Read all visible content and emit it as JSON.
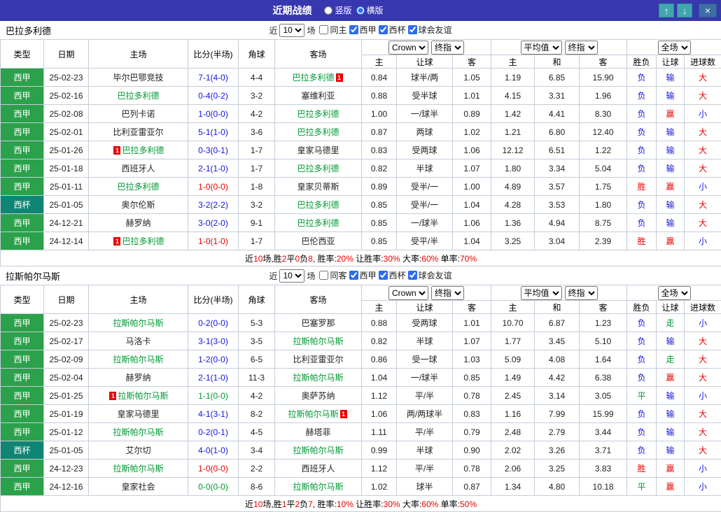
{
  "titlebar": {
    "title": "近期战绩",
    "view_options": [
      {
        "label": "竖版",
        "selected": false
      },
      {
        "label": "横版",
        "selected": true
      }
    ],
    "up_icon": "↑",
    "down_icon": "↓",
    "close_icon": "×"
  },
  "colors": {
    "titlebar_bg": "#3737af",
    "liga_badge_bg": "#2ba14b",
    "cup_badge_bg": "#0f8573",
    "win_red": "#e80000",
    "loss_blue": "#1515dd",
    "draw_green": "#009933",
    "focal_team_green": "#009933"
  },
  "table_header": {
    "static_cols": [
      "类型",
      "日期",
      "主场",
      "比分(半场)",
      "角球",
      "客场"
    ],
    "group1": {
      "selects": [
        "Crown",
        "终指"
      ],
      "cols": [
        "主",
        "让球",
        "客"
      ]
    },
    "group2": {
      "selects": [
        "平均值",
        "终指"
      ],
      "cols": [
        "主",
        "和",
        "客"
      ]
    },
    "group3": {
      "selects": [
        "全场"
      ],
      "cols": [
        "胜负",
        "让球",
        "进球数"
      ]
    }
  },
  "sections": [
    {
      "team": "巴拉多利德",
      "filter": {
        "prefix": "近",
        "count": "10",
        "suffix": "场",
        "checkboxes": [
          {
            "label": "同主",
            "checked": false
          },
          {
            "label": "西甲",
            "checked": true
          },
          {
            "label": "西杯",
            "checked": true
          },
          {
            "label": "球会友谊",
            "checked": true
          }
        ]
      },
      "rows": [
        {
          "lg": "西甲",
          "date": "25-02-23",
          "home": "毕尔巴鄂竞技",
          "hf": false,
          "hrc": "",
          "score": "7-1(4-0)",
          "cor": "4-4",
          "away": "巴拉多利德",
          "af": true,
          "arc": "1",
          "o1": "0.84",
          "hc": "球半/两",
          "o2": "1.05",
          "m1": "1.19",
          "m2": "6.85",
          "m3": "15.90",
          "r1": "负",
          "r2": "输",
          "r3": "大"
        },
        {
          "lg": "西甲",
          "date": "25-02-16",
          "home": "巴拉多利德",
          "hf": true,
          "hrc": "",
          "score": "0-4(0-2)",
          "cor": "3-2",
          "away": "塞维利亚",
          "af": false,
          "arc": "",
          "o1": "0.88",
          "hc": "受半球",
          "o2": "1.01",
          "m1": "4.15",
          "m2": "3.31",
          "m3": "1.96",
          "r1": "负",
          "r2": "输",
          "r3": "大"
        },
        {
          "lg": "西甲",
          "date": "25-02-08",
          "home": "巴列卡诺",
          "hf": false,
          "hrc": "",
          "score": "1-0(0-0)",
          "cor": "4-2",
          "away": "巴拉多利德",
          "af": true,
          "arc": "",
          "o1": "1.00",
          "hc": "一/球半",
          "o2": "0.89",
          "m1": "1.42",
          "m2": "4.41",
          "m3": "8.30",
          "r1": "负",
          "r2": "赢",
          "r3": "小"
        },
        {
          "lg": "西甲",
          "date": "25-02-01",
          "home": "比利亚雷亚尔",
          "hf": false,
          "hrc": "",
          "score": "5-1(1-0)",
          "cor": "3-6",
          "away": "巴拉多利德",
          "af": true,
          "arc": "",
          "o1": "0.87",
          "hc": "两球",
          "o2": "1.02",
          "m1": "1.21",
          "m2": "6.80",
          "m3": "12.40",
          "r1": "负",
          "r2": "输",
          "r3": "大"
        },
        {
          "lg": "西甲",
          "date": "25-01-26",
          "home": "巴拉多利德",
          "hf": true,
          "hrc": "1",
          "score": "0-3(0-1)",
          "cor": "1-7",
          "away": "皇家马德里",
          "af": false,
          "arc": "",
          "o1": "0.83",
          "hc": "受两球",
          "o2": "1.06",
          "m1": "12.12",
          "m2": "6.51",
          "m3": "1.22",
          "r1": "负",
          "r2": "输",
          "r3": "大"
        },
        {
          "lg": "西甲",
          "date": "25-01-18",
          "home": "西班牙人",
          "hf": false,
          "hrc": "",
          "score": "2-1(1-0)",
          "cor": "1-7",
          "away": "巴拉多利德",
          "af": true,
          "arc": "",
          "o1": "0.82",
          "hc": "半球",
          "o2": "1.07",
          "m1": "1.80",
          "m2": "3.34",
          "m3": "5.04",
          "r1": "负",
          "r2": "输",
          "r3": "大"
        },
        {
          "lg": "西甲",
          "date": "25-01-11",
          "home": "巴拉多利德",
          "hf": true,
          "hrc": "",
          "score": "1-0(0-0)",
          "cor": "1-8",
          "away": "皇家贝蒂斯",
          "af": false,
          "arc": "",
          "o1": "0.89",
          "hc": "受半/一",
          "o2": "1.00",
          "m1": "4.89",
          "m2": "3.57",
          "m3": "1.75",
          "r1": "胜",
          "r2": "赢",
          "r3": "小"
        },
        {
          "lg": "西杯",
          "date": "25-01-05",
          "home": "奥尔伦斯",
          "hf": false,
          "hrc": "",
          "score": "3-2(2-2)",
          "cor": "3-2",
          "away": "巴拉多利德",
          "af": true,
          "arc": "",
          "o1": "0.85",
          "hc": "受半/一",
          "o2": "1.04",
          "m1": "4.28",
          "m2": "3.53",
          "m3": "1.80",
          "r1": "负",
          "r2": "输",
          "r3": "大"
        },
        {
          "lg": "西甲",
          "date": "24-12-21",
          "home": "赫罗纳",
          "hf": false,
          "hrc": "",
          "score": "3-0(2-0)",
          "cor": "9-1",
          "away": "巴拉多利德",
          "af": true,
          "arc": "",
          "o1": "0.85",
          "hc": "一/球半",
          "o2": "1.06",
          "m1": "1.36",
          "m2": "4.94",
          "m3": "8.75",
          "r1": "负",
          "r2": "输",
          "r3": "大"
        },
        {
          "lg": "西甲",
          "date": "24-12-14",
          "home": "巴拉多利德",
          "hf": true,
          "hrc": "1",
          "score": "1-0(1-0)",
          "cor": "1-7",
          "away": "巴伦西亚",
          "af": false,
          "arc": "",
          "o1": "0.85",
          "hc": "受平/半",
          "o2": "1.04",
          "m1": "3.25",
          "m2": "3.04",
          "m3": "2.39",
          "r1": "胜",
          "r2": "赢",
          "r3": "小"
        }
      ],
      "summary": [
        [
          "近",
          0
        ],
        [
          "10",
          1
        ],
        [
          "场,胜",
          0
        ],
        [
          "2",
          1
        ],
        [
          "平",
          0
        ],
        [
          "0",
          1
        ],
        [
          "负",
          0
        ],
        [
          "8",
          1
        ],
        [
          ", 胜率:",
          0
        ],
        [
          "20%",
          1
        ],
        [
          " 让胜率:",
          0
        ],
        [
          "30%",
          1
        ],
        [
          " 大率:",
          0
        ],
        [
          "60%",
          1
        ],
        [
          " 单率:",
          0
        ],
        [
          "70%",
          1
        ]
      ]
    },
    {
      "team": "拉斯帕尔马斯",
      "filter": {
        "prefix": "近",
        "count": "10",
        "suffix": "场",
        "checkboxes": [
          {
            "label": "同客",
            "checked": false
          },
          {
            "label": "西甲",
            "checked": true
          },
          {
            "label": "西杯",
            "checked": true
          },
          {
            "label": "球会友谊",
            "checked": true
          }
        ]
      },
      "rows": [
        {
          "lg": "西甲",
          "date": "25-02-23",
          "home": "拉斯帕尔马斯",
          "hf": true,
          "hrc": "",
          "score": "0-2(0-0)",
          "cor": "5-3",
          "away": "巴塞罗那",
          "af": false,
          "arc": "",
          "o1": "0.88",
          "hc": "受两球",
          "o2": "1.01",
          "m1": "10.70",
          "m2": "6.87",
          "m3": "1.23",
          "r1": "负",
          "r2": "走",
          "r3": "小"
        },
        {
          "lg": "西甲",
          "date": "25-02-17",
          "home": "马洛卡",
          "hf": false,
          "hrc": "",
          "score": "3-1(3-0)",
          "cor": "3-5",
          "away": "拉斯帕尔马斯",
          "af": true,
          "arc": "",
          "o1": "0.82",
          "hc": "半球",
          "o2": "1.07",
          "m1": "1.77",
          "m2": "3.45",
          "m3": "5.10",
          "r1": "负",
          "r2": "输",
          "r3": "大"
        },
        {
          "lg": "西甲",
          "date": "25-02-09",
          "home": "拉斯帕尔马斯",
          "hf": true,
          "hrc": "",
          "score": "1-2(0-0)",
          "cor": "6-5",
          "away": "比利亚雷亚尔",
          "af": false,
          "arc": "",
          "o1": "0.86",
          "hc": "受一球",
          "o2": "1.03",
          "m1": "5.09",
          "m2": "4.08",
          "m3": "1.64",
          "r1": "负",
          "r2": "走",
          "r3": "大"
        },
        {
          "lg": "西甲",
          "date": "25-02-04",
          "home": "赫罗纳",
          "hf": false,
          "hrc": "",
          "score": "2-1(1-0)",
          "cor": "11-3",
          "away": "拉斯帕尔马斯",
          "af": true,
          "arc": "",
          "o1": "1.04",
          "hc": "一/球半",
          "o2": "0.85",
          "m1": "1.49",
          "m2": "4.42",
          "m3": "6.38",
          "r1": "负",
          "r2": "赢",
          "r3": "大"
        },
        {
          "lg": "西甲",
          "date": "25-01-25",
          "home": "拉斯帕尔马斯",
          "hf": true,
          "hrc": "1",
          "score": "1-1(0-0)",
          "cor": "4-2",
          "away": "奥萨苏纳",
          "af": false,
          "arc": "",
          "o1": "1.12",
          "hc": "平/半",
          "o2": "0.78",
          "m1": "2.45",
          "m2": "3.14",
          "m3": "3.05",
          "r1": "平",
          "r2": "输",
          "r3": "小"
        },
        {
          "lg": "西甲",
          "date": "25-01-19",
          "home": "皇家马德里",
          "hf": false,
          "hrc": "",
          "score": "4-1(3-1)",
          "cor": "8-2",
          "away": "拉斯帕尔马斯",
          "af": true,
          "arc": "1",
          "o1": "1.06",
          "hc": "两/两球半",
          "o2": "0.83",
          "m1": "1.16",
          "m2": "7.99",
          "m3": "15.99",
          "r1": "负",
          "r2": "输",
          "r3": "大"
        },
        {
          "lg": "西甲",
          "date": "25-01-12",
          "home": "拉斯帕尔马斯",
          "hf": true,
          "hrc": "",
          "score": "0-2(0-1)",
          "cor": "4-5",
          "away": "赫塔菲",
          "af": false,
          "arc": "",
          "o1": "1.11",
          "hc": "平/半",
          "o2": "0.79",
          "m1": "2.48",
          "m2": "2.79",
          "m3": "3.44",
          "r1": "负",
          "r2": "输",
          "r3": "大"
        },
        {
          "lg": "西杯",
          "date": "25-01-05",
          "home": "艾尔切",
          "hf": false,
          "hrc": "",
          "score": "4-0(1-0)",
          "cor": "3-4",
          "away": "拉斯帕尔马斯",
          "af": true,
          "arc": "",
          "o1": "0.99",
          "hc": "半球",
          "o2": "0.90",
          "m1": "2.02",
          "m2": "3.26",
          "m3": "3.71",
          "r1": "负",
          "r2": "输",
          "r3": "大"
        },
        {
          "lg": "西甲",
          "date": "24-12-23",
          "home": "拉斯帕尔马斯",
          "hf": true,
          "hrc": "",
          "score": "1-0(0-0)",
          "cor": "2-2",
          "away": "西班牙人",
          "af": false,
          "arc": "",
          "o1": "1.12",
          "hc": "平/半",
          "o2": "0.78",
          "m1": "2.06",
          "m2": "3.25",
          "m3": "3.83",
          "r1": "胜",
          "r2": "赢",
          "r3": "小"
        },
        {
          "lg": "西甲",
          "date": "24-12-16",
          "home": "皇家社会",
          "hf": false,
          "hrc": "",
          "score": "0-0(0-0)",
          "cor": "8-6",
          "away": "拉斯帕尔马斯",
          "af": true,
          "arc": "",
          "o1": "1.02",
          "hc": "球半",
          "o2": "0.87",
          "m1": "1.34",
          "m2": "4.80",
          "m3": "10.18",
          "r1": "平",
          "r2": "赢",
          "r3": "小"
        }
      ],
      "summary": [
        [
          "近",
          0
        ],
        [
          "10",
          1
        ],
        [
          "场,胜",
          0
        ],
        [
          "1",
          1
        ],
        [
          "平",
          0
        ],
        [
          "2",
          1
        ],
        [
          "负",
          0
        ],
        [
          "7",
          1
        ],
        [
          ", 胜率:",
          0
        ],
        [
          "10%",
          1
        ],
        [
          " 让胜率:",
          0
        ],
        [
          "30%",
          1
        ],
        [
          " 大率:",
          0
        ],
        [
          "60%",
          1
        ],
        [
          " 单率:",
          0
        ],
        [
          "50%",
          1
        ]
      ]
    }
  ]
}
